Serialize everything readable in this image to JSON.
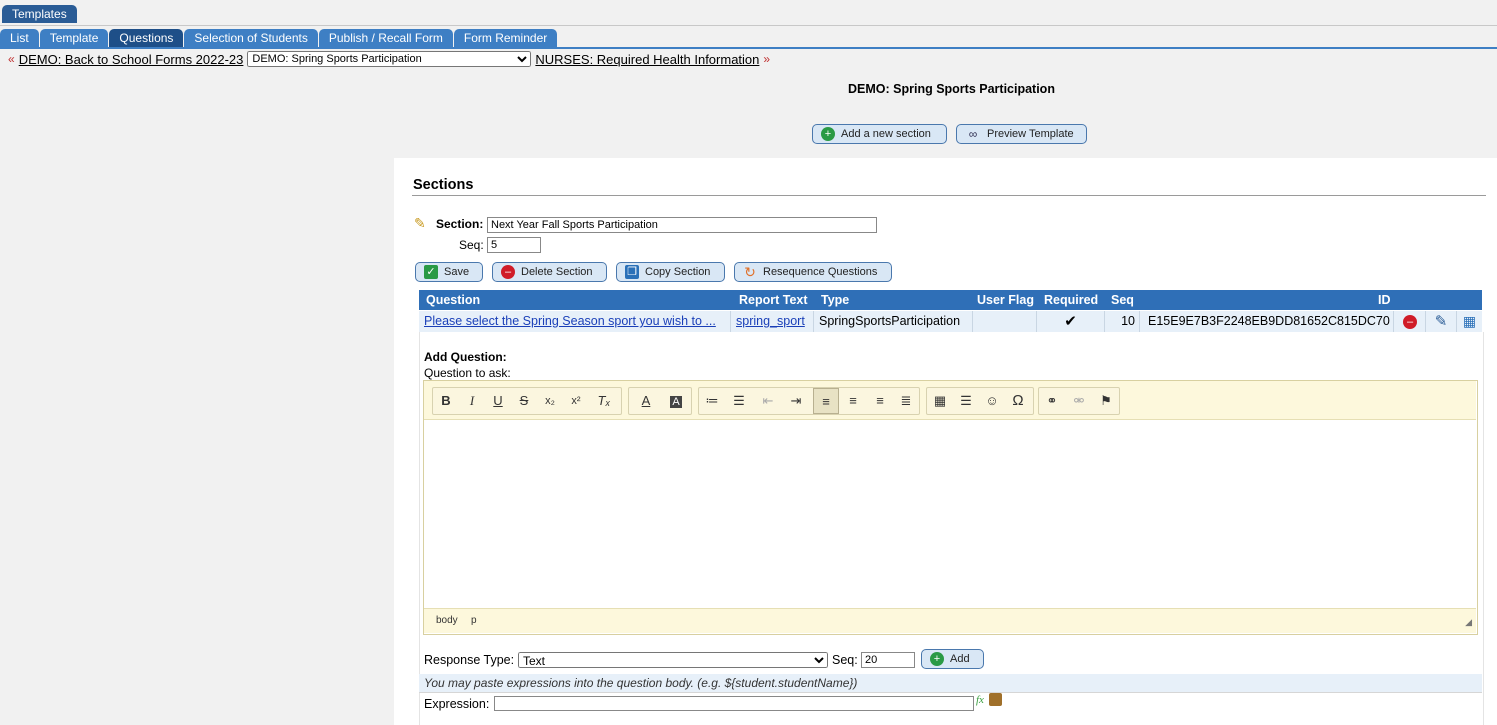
{
  "top_tab": "Templates",
  "sub_tabs": [
    "List",
    "Template",
    "Questions",
    "Selection of Students",
    "Publish / Recall Form",
    "Form Reminder"
  ],
  "breadcrumb": {
    "prev_arrow": "«",
    "prev_link": "DEMO: Back to School Forms 2022-23",
    "selected_form": "DEMO: Spring Sports Participation",
    "next_link": "NURSES: Required Health Information",
    "next_arrow": "»"
  },
  "page_title": "DEMO: Spring Sports Participation",
  "actions": {
    "add_section": "Add a new section",
    "preview": "Preview Template"
  },
  "sections": {
    "heading": "Sections",
    "section_label": "Section:",
    "section_value": "Next Year Fall Sports Participation",
    "seq_label": "Seq:",
    "seq_value": "5",
    "buttons": {
      "save": "Save",
      "delete": "Delete Section",
      "copy": "Copy Section",
      "resequence": "Resequence Questions"
    }
  },
  "questions_table": {
    "headers": [
      "Question",
      "Report Text",
      "Type",
      "User Flag",
      "Required",
      "Seq",
      "ID"
    ],
    "rows": [
      {
        "question": "Please select the Spring Season sport you wish to ...",
        "report_text": "spring_sport",
        "type": "SpringSportsParticipation",
        "user_flag": "",
        "required": "✔",
        "seq": "10",
        "id": "E15E9E7B3F2248EB9DD81652C815DC70"
      }
    ]
  },
  "add_question": {
    "heading": "Add Question:",
    "subheading": "Question to ask:",
    "status_path": [
      "body",
      "p"
    ],
    "response_type_label": "Response Type:",
    "response_type_value": "Text",
    "seq_label": "Seq:",
    "seq_value": "20",
    "add_button": "Add",
    "hint": "You may paste expressions into the question body. (e.g. ${student.studentName})",
    "expression_label": "Expression:"
  },
  "toolbar": {
    "bold": "B",
    "italic": "I",
    "underline": "U",
    "strike": "S",
    "subscript": "x₂",
    "superscript": "x²",
    "clear_format": "Tₓ",
    "text_color": "A",
    "bg_color": "A",
    "special_char": "Ω"
  },
  "colors": {
    "tab_bg": "#3e7fc4",
    "tab_active": "#1e4f88",
    "table_header": "#2f6fb7",
    "row_bg": "#e7f0f9",
    "editor_toolbar": "#fdf8dc"
  }
}
